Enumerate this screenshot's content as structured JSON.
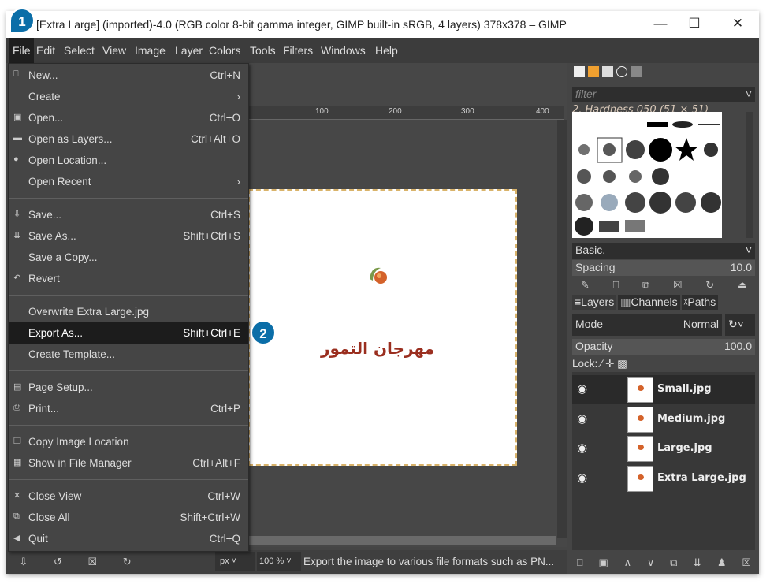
{
  "window": {
    "title": "[Extra Large] (imported)-4.0 (RGB color 8-bit gamma integer, GIMP built-in sRGB, 4 layers) 378x378 – GIMP",
    "minimize": "—",
    "maximize": "☐",
    "close": "✕"
  },
  "menubar": [
    "File",
    "Edit",
    "Select",
    "View",
    "Image",
    "Layer",
    "Colors",
    "Tools",
    "Filters",
    "Windows",
    "Help"
  ],
  "file_menu": [
    {
      "icon": "new-icon",
      "glyph": "⎕",
      "label": "New...",
      "shortcut": "Ctrl+N"
    },
    {
      "label": "Create",
      "shortcut": "›"
    },
    {
      "icon": "open-icon",
      "glyph": "▣",
      "label": "Open...",
      "shortcut": "Ctrl+O"
    },
    {
      "icon": "open-layers-icon",
      "glyph": "▬",
      "label": "Open as Layers...",
      "shortcut": "Ctrl+Alt+O"
    },
    {
      "icon": "globe-icon",
      "glyph": "●",
      "label": "Open Location...",
      "shortcut": ""
    },
    {
      "label": "Open Recent",
      "shortcut": "›"
    },
    {
      "sep": true
    },
    {
      "icon": "save-icon",
      "glyph": "⇩",
      "label": "Save...",
      "shortcut": "Ctrl+S"
    },
    {
      "icon": "save-as-icon",
      "glyph": "⇊",
      "label": "Save As...",
      "shortcut": "Shift+Ctrl+S"
    },
    {
      "label": "Save a Copy...",
      "shortcut": ""
    },
    {
      "icon": "revert-icon",
      "glyph": "↶",
      "label": "Revert",
      "shortcut": ""
    },
    {
      "sep": true
    },
    {
      "label": "Overwrite Extra Large.jpg",
      "shortcut": ""
    },
    {
      "label": "Export As...",
      "shortcut": "Shift+Ctrl+E",
      "highlighted": true
    },
    {
      "label": "Create Template...",
      "shortcut": ""
    },
    {
      "sep": true
    },
    {
      "icon": "page-setup-icon",
      "glyph": "▤",
      "label": "Page Setup...",
      "shortcut": ""
    },
    {
      "icon": "print-icon",
      "glyph": "⎙",
      "label": "Print...",
      "shortcut": "Ctrl+P"
    },
    {
      "sep": true
    },
    {
      "icon": "copy-location-icon",
      "glyph": "❐",
      "label": "Copy Image Location",
      "shortcut": ""
    },
    {
      "icon": "file-manager-icon",
      "glyph": "▦",
      "label": "Show in File Manager",
      "shortcut": "Ctrl+Alt+F"
    },
    {
      "sep": true
    },
    {
      "icon": "close-icon",
      "glyph": "✕",
      "label": "Close View",
      "shortcut": "Ctrl+W"
    },
    {
      "icon": "close-all-icon",
      "glyph": "⧉",
      "label": "Close All",
      "shortcut": "Shift+Ctrl+W"
    },
    {
      "icon": "quit-icon",
      "glyph": "◀",
      "label": "Quit",
      "shortcut": "Ctrl+Q"
    }
  ],
  "badges": {
    "step1": "1",
    "step2": "2",
    "color": "#0b6ea8"
  },
  "ruler": [
    "100",
    "200",
    "300",
    "400"
  ],
  "canvas": {
    "arabic_text": "مهرجان التمور"
  },
  "statusbar": {
    "unit": "px",
    "zoom": "100 %",
    "message": "Export the image to various file formats such as PN..."
  },
  "brushes": {
    "filter_placeholder": "filter",
    "selected": "2. Hardness 050 (51 × 51)",
    "preset": "Basic,",
    "spacing_label": "Spacing",
    "spacing_value": "10.0"
  },
  "layers_panel": {
    "tabs": [
      "Layers",
      "Channels",
      "Paths"
    ],
    "mode_label": "Mode",
    "mode_value": "Normal",
    "opacity_label": "Opacity",
    "opacity_value": "100.0",
    "lock_label": "Lock:",
    "layers": [
      {
        "name": "Small.jpg",
        "visible": true,
        "selected": true
      },
      {
        "name": "Medium.jpg",
        "visible": true
      },
      {
        "name": "Large.jpg",
        "visible": true
      },
      {
        "name": "Extra Large.jpg",
        "visible": true
      }
    ]
  }
}
